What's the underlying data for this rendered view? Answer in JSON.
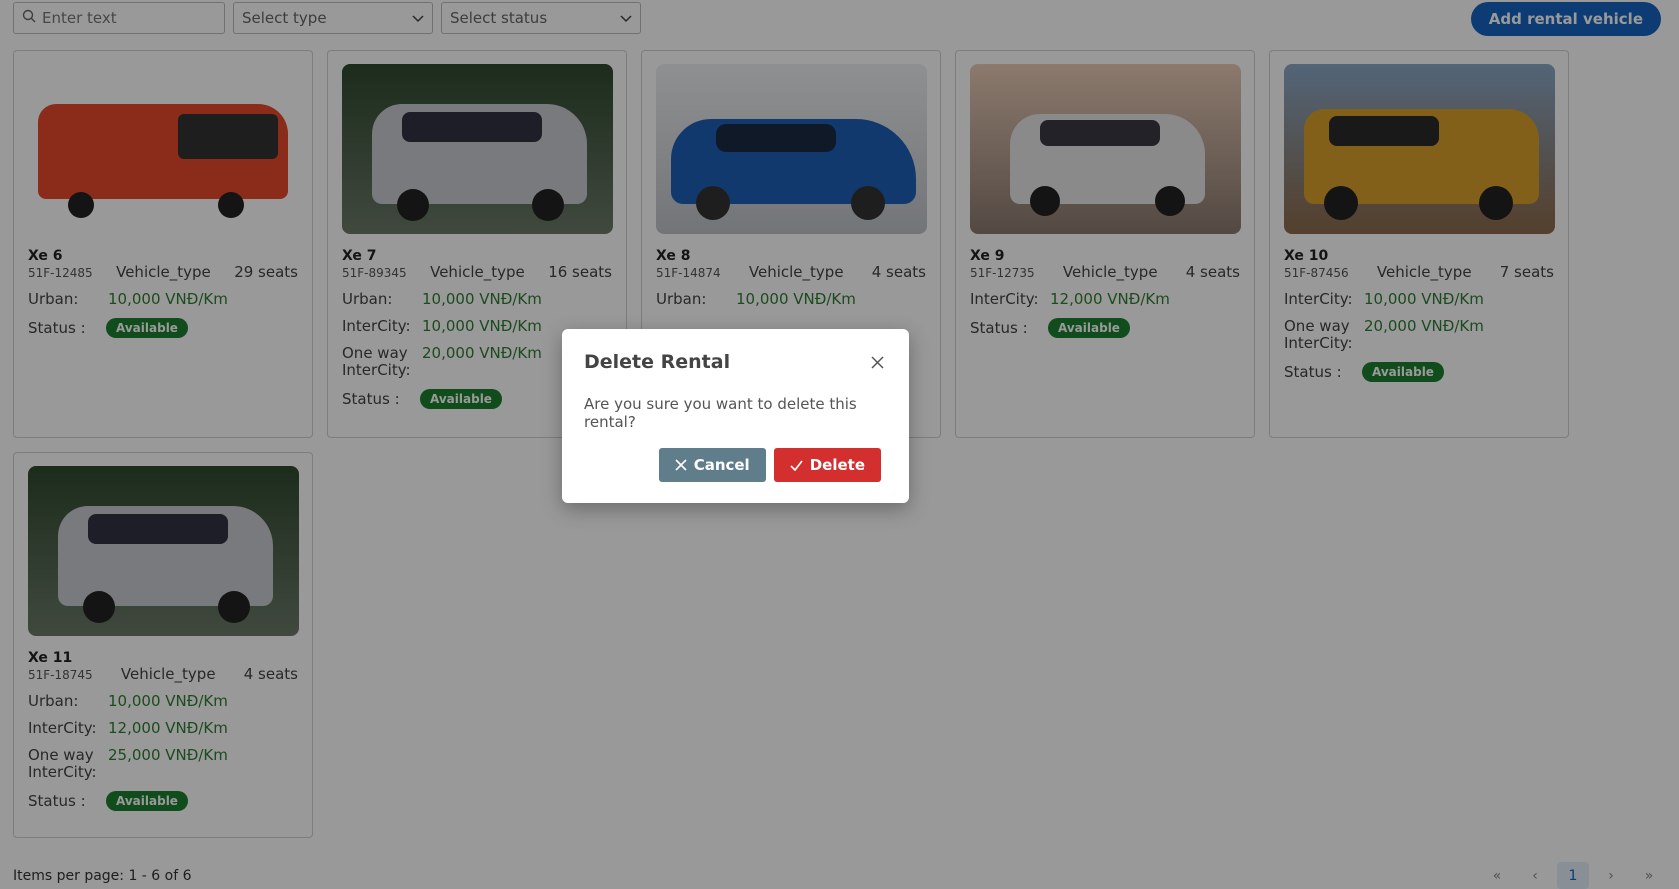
{
  "toolbar": {
    "search_placeholder": "Enter text",
    "type_select": "Select type",
    "status_select": "Select status",
    "add_label": "Add rental vehicle"
  },
  "cards": [
    {
      "name": "Xe 6",
      "plate": "51F-12485",
      "type": "Vehicle_type",
      "seats": "29 seats",
      "rates": [
        {
          "k": "Urban:",
          "v": "10,000 VNĐ/Km"
        }
      ],
      "status_label": "Status :",
      "status": "Available",
      "photo": "bus"
    },
    {
      "name": "Xe 7",
      "plate": "51F-89345",
      "type": "Vehicle_type",
      "seats": "16 seats",
      "rates": [
        {
          "k": "Urban:",
          "v": "10,000 VNĐ/Km"
        },
        {
          "k": "InterCity:",
          "v": "10,000 VNĐ/Km"
        },
        {
          "k": "One way InterCity:",
          "v": "20,000 VNĐ/Km"
        }
      ],
      "status_label": "Status :",
      "status": "Available",
      "photo": "suv-silver"
    },
    {
      "name": "Xe 8",
      "plate": "51F-14874",
      "type": "Vehicle_type",
      "seats": "4 seats",
      "rates": [
        {
          "k": "Urban:",
          "v": "10,000 VNĐ/Km"
        }
      ],
      "status_label": "",
      "status": "",
      "photo": "sedan-blue"
    },
    {
      "name": "Xe 9",
      "plate": "51F-12735",
      "type": "Vehicle_type",
      "seats": "4 seats",
      "rates": [
        {
          "k": "InterCity:",
          "v": "12,000 VNĐ/Km"
        }
      ],
      "status_label": "Status :",
      "status": "Available",
      "photo": "suv-white"
    },
    {
      "name": "Xe 10",
      "plate": "51F-87456",
      "type": "Vehicle_type",
      "seats": "7 seats",
      "rates": [
        {
          "k": "InterCity:",
          "v": "10,000 VNĐ/Km"
        },
        {
          "k": "One way InterCity:",
          "v": "20,000 VNĐ/Km"
        }
      ],
      "status_label": "Status :",
      "status": "Available",
      "photo": "pickup-yellow"
    },
    {
      "name": "Xe 11",
      "plate": "51F-18745",
      "type": "Vehicle_type",
      "seats": "4 seats",
      "rates": [
        {
          "k": "Urban:",
          "v": "10,000 VNĐ/Km"
        },
        {
          "k": "InterCity:",
          "v": "12,000 VNĐ/Km"
        },
        {
          "k": "One way InterCity:",
          "v": "25,000 VNĐ/Km"
        }
      ],
      "status_label": "Status :",
      "status": "Available",
      "photo": "suv-silver"
    }
  ],
  "footer": {
    "items_per_page": "Items per page: 1 - 6 of 6",
    "current_page": "1"
  },
  "dialog": {
    "title": "Delete Rental",
    "message": "Are you sure you want to delete this rental?",
    "cancel_label": "Cancel",
    "delete_label": "Delete"
  },
  "colors": {
    "primary": "#1565c0",
    "price": "#2e7d32",
    "badge": "#1b7f2f",
    "cancel": "#607d8b",
    "delete": "#d32f2f"
  }
}
